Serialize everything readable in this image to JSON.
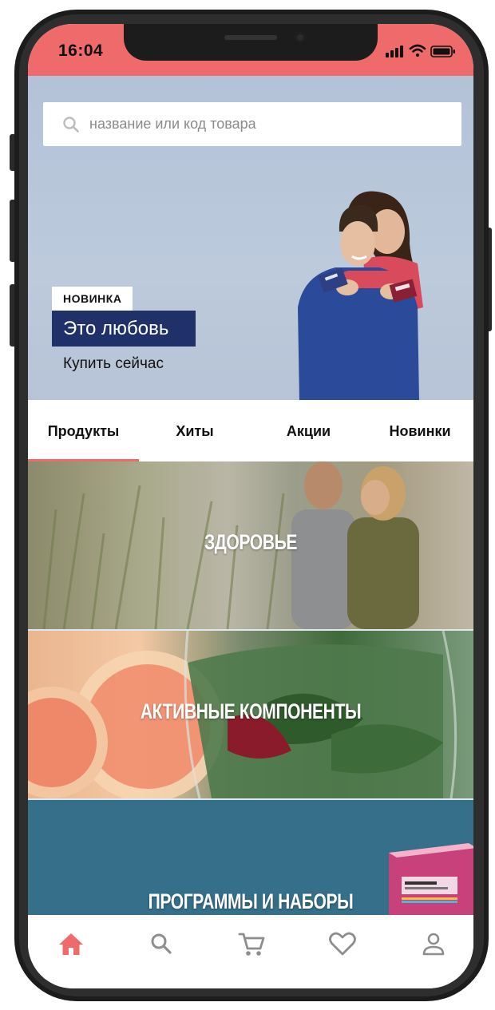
{
  "status_bar": {
    "time": "16:04"
  },
  "search": {
    "placeholder": "название или код товара"
  },
  "hero": {
    "badge": "НОВИНКА",
    "title": "Это любовь",
    "link": "Купить сейчас"
  },
  "tabs": [
    {
      "label": "Продукты",
      "active": true
    },
    {
      "label": "Хиты",
      "active": false
    },
    {
      "label": "Акции",
      "active": false
    },
    {
      "label": "Новинки",
      "active": false
    }
  ],
  "categories": [
    {
      "title": "ЗДОРОВЬЕ"
    },
    {
      "title": "АКТИВНЫЕ КОМПОНЕНТЫ"
    },
    {
      "title": "ПРОГРАММЫ И НАБОРЫ"
    }
  ],
  "bottom_nav": [
    {
      "icon": "home-icon",
      "active": true
    },
    {
      "icon": "search-icon"
    },
    {
      "icon": "cart-icon"
    },
    {
      "icon": "heart-icon"
    },
    {
      "icon": "profile-icon"
    }
  ],
  "colors": {
    "accent": "#ef6b6b",
    "promo_navy": "#1f3168",
    "inactive_icon": "#8e8e8e"
  }
}
